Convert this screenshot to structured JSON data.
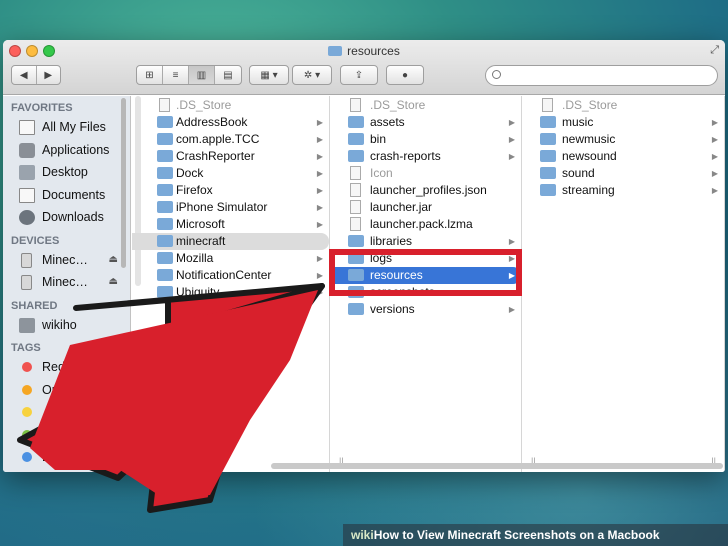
{
  "window": {
    "title": "resources",
    "search_placeholder": ""
  },
  "toolbar": {
    "back": "◀",
    "forward": "▶",
    "view_icon": "⊞",
    "view_list": "≡",
    "view_column": "▥",
    "view_cover": "▤",
    "arrange": "▦ ▾",
    "action": "✲ ▾",
    "share": "⇪",
    "tag": "●"
  },
  "sidebar": {
    "favorites_heading": "FAVORITES",
    "favorites": [
      {
        "label": "All My Files",
        "icon": "all-files-icon"
      },
      {
        "label": "Applications",
        "icon": "applications-icon"
      },
      {
        "label": "Desktop",
        "icon": "desktop-icon"
      },
      {
        "label": "Documents",
        "icon": "documents-icon"
      },
      {
        "label": "Downloads",
        "icon": "downloads-icon"
      }
    ],
    "devices_heading": "DEVICES",
    "devices": [
      {
        "label": "Minec…",
        "icon": "drive-icon"
      },
      {
        "label": "Minec…",
        "icon": "drive-icon"
      }
    ],
    "shared_heading": "SHARED",
    "shared": [
      {
        "label": "wikiho",
        "icon": "shared-computer-icon"
      }
    ],
    "tags_heading": "TAGS",
    "tags": [
      {
        "label": "Red",
        "color": "#f0524f"
      },
      {
        "label": "Or",
        "color": "#f5a623"
      },
      {
        "label": "",
        "color": "#f7d23e"
      },
      {
        "label": "",
        "color": "#7ac142"
      },
      {
        "label": "Blue",
        "color": "#4a90e2"
      }
    ]
  },
  "column1": [
    {
      "label": ".DS_Store",
      "type": "doc",
      "dim": true
    },
    {
      "label": "AddressBook",
      "type": "folder"
    },
    {
      "label": "com.apple.TCC",
      "type": "folder"
    },
    {
      "label": "CrashReporter",
      "type": "folder"
    },
    {
      "label": "Dock",
      "type": "folder"
    },
    {
      "label": "Firefox",
      "type": "folder"
    },
    {
      "label": "iPhone Simulator",
      "type": "folder"
    },
    {
      "label": "Microsoft",
      "type": "folder"
    },
    {
      "label": "minecraft",
      "type": "folder",
      "selected": true
    },
    {
      "label": "Mozilla",
      "type": "folder"
    },
    {
      "label": "NotificationCenter",
      "type": "folder"
    },
    {
      "label": "Ubiquity",
      "type": "folder"
    }
  ],
  "column2": [
    {
      "label": ".DS_Store",
      "type": "doc",
      "dim": true
    },
    {
      "label": "assets",
      "type": "folder"
    },
    {
      "label": "bin",
      "type": "folder"
    },
    {
      "label": "crash-reports",
      "type": "folder"
    },
    {
      "label": "Icon",
      "type": "doc",
      "dim": true
    },
    {
      "label": "launcher_profiles.json",
      "type": "doc"
    },
    {
      "label": "launcher.jar",
      "type": "doc"
    },
    {
      "label": "launcher.pack.lzma",
      "type": "doc"
    },
    {
      "label": "libraries",
      "type": "folder"
    },
    {
      "label": "logs",
      "type": "folder"
    },
    {
      "label": "resources",
      "type": "folder",
      "selected": true
    },
    {
      "label": "screenshots",
      "type": "folder"
    },
    {
      "label": "versions",
      "type": "folder"
    }
  ],
  "column3": [
    {
      "label": ".DS_Store",
      "type": "doc",
      "dim": true
    },
    {
      "label": "music",
      "type": "folder"
    },
    {
      "label": "newmusic",
      "type": "folder"
    },
    {
      "label": "newsound",
      "type": "folder"
    },
    {
      "label": "sound",
      "type": "folder"
    },
    {
      "label": "streaming",
      "type": "folder"
    }
  ],
  "caption": {
    "brand": "wiki",
    "text": "How to View Minecraft Screenshots on a Macbook"
  },
  "colors": {
    "highlight_red": "#d8202c",
    "selection_blue": "#3875d7"
  }
}
